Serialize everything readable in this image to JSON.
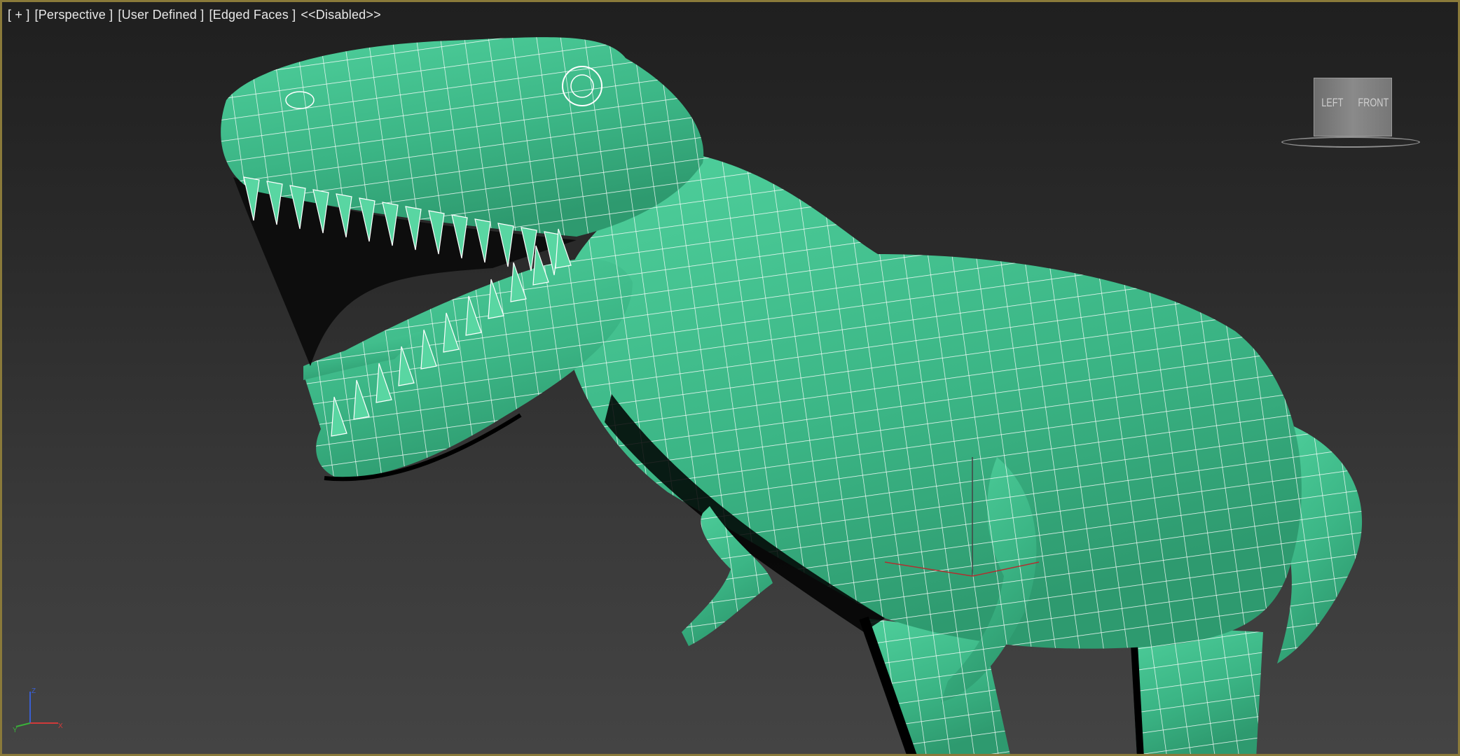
{
  "viewport": {
    "labels": [
      "[ + ]",
      "[Perspective ]",
      "[User Defined ]",
      "[Edged Faces ]",
      "<<Disabled>>"
    ]
  },
  "viewcube": {
    "left_label": "LEFT",
    "front_label": "FRONT"
  },
  "axis_tripod": {
    "z": "Z",
    "y": "Y",
    "x": "X"
  },
  "colors": {
    "model_fill": "#3fbb8a",
    "wireframe": "#ffffff",
    "viewport_border": "#8a7a3a"
  },
  "icons": [
    "viewcube-icon",
    "axis-tripod-icon",
    "gizmo-icon"
  ]
}
